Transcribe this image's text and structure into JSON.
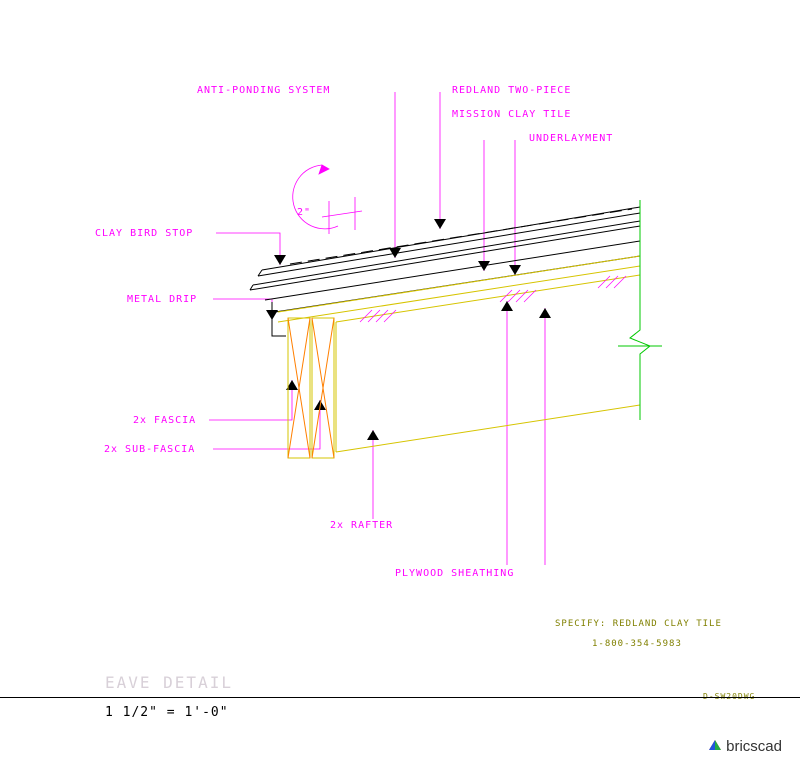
{
  "labels": {
    "anti_ponding": "ANTI-PONDING SYSTEM",
    "redland1": "REDLAND TWO-PIECE",
    "redland2": "MISSION CLAY TILE",
    "underlayment": "UNDERLAYMENT",
    "clay_bird_stop": "CLAY BIRD STOP",
    "metal_drip": "METAL DRIP",
    "fascia": "2x FASCIA",
    "sub_fascia": "2x SUB-FASCIA",
    "rafter": "2x RAFTER",
    "plywood": "PLYWOOD SHEATHING",
    "dim2": "2\""
  },
  "title": "EAVE DETAIL",
  "scale": "1 1/2\" = 1'-0\"",
  "spec1": "SPECIFY: REDLAND CLAY TILE",
  "spec2": "1-800-354-5983",
  "dwg": "D-SW20DWG",
  "brand": "bricscad"
}
